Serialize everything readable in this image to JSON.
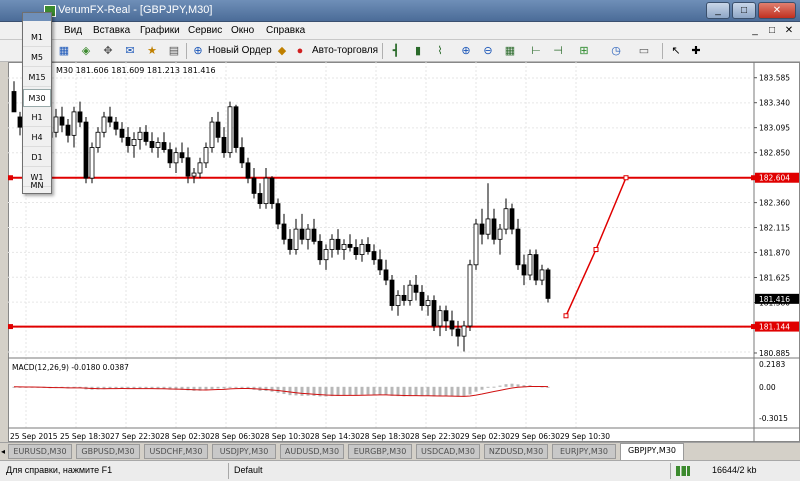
{
  "window": {
    "title": "VerumFX-Real - [GBPJPY,M30]",
    "min_label": "_",
    "max_label": "□",
    "close_label": "✕",
    "inner_min": "_",
    "inner_max": "□",
    "inner_close": "✕"
  },
  "menu": [
    "Вид",
    "Вставка",
    "Графики",
    "Сервис",
    "Окно",
    "Справка"
  ],
  "toolbar": {
    "new_order": "Новый Ордер",
    "auto_trading": "Авто-торговля"
  },
  "timeframes": [
    "M1",
    "M5",
    "M15",
    "M30",
    "H1",
    "H4",
    "D1",
    "W1",
    "MN"
  ],
  "active_timeframe": "M30",
  "ohlc_text": "181.606 181.609 181.213 181.416",
  "ohlc_prefix": "M30",
  "macd_label": "MACD(12,26,9) -0.0180 0.0387",
  "chart_data": {
    "type": "candlestick",
    "price_ticks": [
      "183.585",
      "183.340",
      "183.095",
      "182.850",
      "182.605",
      "182.360",
      "182.115",
      "181.870",
      "181.625",
      "181.380",
      "181.135",
      "180.885"
    ],
    "price_range": [
      180.875,
      183.7
    ],
    "current_price_label": "181.416",
    "current_price": 181.416,
    "levels": [
      {
        "label": "182.604",
        "value": 182.604,
        "color": "#e00000"
      },
      {
        "label": "181.144",
        "value": 181.144,
        "color": "#e00000"
      }
    ],
    "projection": [
      {
        "bar": 92,
        "value": 181.25
      },
      {
        "bar": 97,
        "value": 181.9
      },
      {
        "bar": 102,
        "value": 182.604
      }
    ],
    "time_labels": [
      "25 Sep 2015",
      "25 Sep 18:30",
      "27 Sep 22:30",
      "28 Sep 02:30",
      "28 Sep 06:30",
      "28 Sep 10:30",
      "28 Sep 14:30",
      "28 Sep 18:30",
      "28 Sep 22:30",
      "29 Sep 02:30",
      "29 Sep 06:30",
      "29 Sep 10:30"
    ],
    "macd_ticks": [
      "0.2183",
      "0.00",
      "-0.3015"
    ],
    "macd_range": [
      -0.36,
      0.24
    ],
    "candles": [
      [
        183.45,
        183.55,
        183.3,
        183.25
      ],
      [
        183.2,
        183.25,
        183.02,
        183.1
      ],
      [
        183.1,
        183.28,
        183.0,
        183.18
      ],
      [
        183.18,
        183.35,
        183.12,
        183.25
      ],
      [
        183.25,
        183.3,
        183.08,
        183.15
      ],
      [
        183.15,
        183.2,
        182.9,
        183.0
      ],
      [
        183.0,
        183.1,
        182.85,
        183.05
      ],
      [
        183.05,
        183.28,
        183.0,
        183.2
      ],
      [
        183.2,
        183.3,
        183.05,
        183.12
      ],
      [
        183.12,
        183.18,
        182.95,
        183.02
      ],
      [
        183.02,
        183.3,
        182.9,
        183.25
      ],
      [
        183.25,
        183.35,
        183.1,
        183.15
      ],
      [
        183.15,
        183.2,
        182.55,
        182.6
      ],
      [
        182.6,
        182.95,
        182.55,
        182.9
      ],
      [
        182.9,
        183.1,
        182.85,
        183.05
      ],
      [
        183.05,
        183.25,
        183.0,
        183.2
      ],
      [
        183.2,
        183.3,
        183.1,
        183.15
      ],
      [
        183.15,
        183.2,
        183.02,
        183.08
      ],
      [
        183.08,
        183.15,
        182.95,
        183.0
      ],
      [
        183.0,
        183.1,
        182.85,
        182.92
      ],
      [
        182.92,
        183.05,
        182.8,
        182.98
      ],
      [
        182.98,
        183.1,
        182.88,
        183.05
      ],
      [
        183.05,
        183.12,
        182.92,
        182.96
      ],
      [
        182.96,
        183.05,
        182.85,
        182.9
      ],
      [
        182.9,
        183.0,
        182.8,
        182.95
      ],
      [
        182.95,
        183.05,
        182.85,
        182.88
      ],
      [
        182.88,
        182.95,
        182.7,
        182.75
      ],
      [
        182.75,
        182.9,
        182.65,
        182.85
      ],
      [
        182.85,
        182.95,
        182.75,
        182.8
      ],
      [
        182.8,
        182.9,
        182.55,
        182.62
      ],
      [
        182.62,
        182.7,
        182.55,
        182.65
      ],
      [
        182.65,
        182.8,
        182.6,
        182.75
      ],
      [
        182.75,
        182.95,
        182.7,
        182.9
      ],
      [
        182.9,
        183.2,
        182.85,
        183.15
      ],
      [
        183.15,
        183.25,
        182.95,
        183.0
      ],
      [
        183.0,
        183.1,
        182.8,
        182.85
      ],
      [
        182.85,
        183.35,
        182.8,
        183.3
      ],
      [
        183.3,
        183.32,
        182.85,
        182.9
      ],
      [
        182.9,
        183.0,
        182.7,
        182.75
      ],
      [
        182.75,
        182.8,
        182.55,
        182.6
      ],
      [
        182.6,
        182.7,
        182.4,
        182.45
      ],
      [
        182.45,
        182.55,
        182.3,
        182.35
      ],
      [
        182.35,
        182.7,
        182.3,
        182.6
      ],
      [
        182.6,
        182.62,
        182.3,
        182.35
      ],
      [
        182.35,
        182.4,
        182.1,
        182.15
      ],
      [
        182.15,
        182.25,
        181.95,
        182.0
      ],
      [
        182.0,
        182.1,
        181.85,
        181.9
      ],
      [
        181.9,
        182.2,
        181.85,
        182.1
      ],
      [
        182.1,
        182.25,
        181.95,
        182.0
      ],
      [
        182.0,
        182.15,
        181.9,
        182.1
      ],
      [
        182.1,
        182.2,
        181.95,
        181.98
      ],
      [
        181.98,
        182.05,
        181.75,
        181.8
      ],
      [
        181.8,
        181.95,
        181.7,
        181.9
      ],
      [
        181.9,
        182.05,
        181.82,
        182.0
      ],
      [
        182.0,
        182.1,
        181.85,
        181.9
      ],
      [
        181.9,
        182.0,
        181.8,
        181.95
      ],
      [
        181.95,
        182.05,
        181.88,
        181.92
      ],
      [
        181.92,
        182.0,
        181.8,
        181.85
      ],
      [
        181.85,
        182.0,
        181.78,
        181.95
      ],
      [
        181.95,
        182.02,
        181.85,
        181.88
      ],
      [
        181.88,
        181.95,
        181.75,
        181.8
      ],
      [
        181.8,
        181.9,
        181.65,
        181.7
      ],
      [
        181.7,
        181.8,
        181.55,
        181.6
      ],
      [
        181.6,
        181.65,
        181.3,
        181.35
      ],
      [
        181.35,
        181.5,
        181.25,
        181.45
      ],
      [
        181.45,
        181.55,
        181.35,
        181.4
      ],
      [
        181.4,
        181.6,
        181.35,
        181.55
      ],
      [
        181.55,
        181.65,
        181.4,
        181.48
      ],
      [
        181.48,
        181.55,
        181.3,
        181.35
      ],
      [
        181.35,
        181.45,
        181.25,
        181.4
      ],
      [
        181.4,
        181.45,
        181.1,
        181.15
      ],
      [
        181.15,
        181.35,
        181.05,
        181.3
      ],
      [
        181.3,
        181.35,
        181.1,
        181.2
      ],
      [
        181.2,
        181.3,
        181.05,
        181.12
      ],
      [
        181.12,
        181.2,
        180.95,
        181.05
      ],
      [
        181.05,
        181.2,
        180.9,
        181.15
      ],
      [
        181.15,
        181.8,
        181.1,
        181.75
      ],
      [
        181.75,
        182.2,
        181.7,
        182.15
      ],
      [
        182.15,
        182.3,
        181.95,
        182.05
      ],
      [
        182.05,
        182.55,
        182.0,
        182.2
      ],
      [
        182.2,
        182.3,
        181.95,
        182.0
      ],
      [
        182.0,
        182.15,
        181.85,
        182.1
      ],
      [
        182.1,
        182.4,
        182.05,
        182.3
      ],
      [
        182.3,
        182.35,
        182.05,
        182.1
      ],
      [
        182.1,
        182.2,
        181.7,
        181.75
      ],
      [
        181.75,
        181.85,
        181.55,
        181.65
      ],
      [
        181.65,
        181.9,
        181.6,
        181.85
      ],
      [
        181.85,
        181.9,
        181.55,
        181.6
      ],
      [
        181.6,
        181.75,
        181.55,
        181.7
      ],
      [
        181.7,
        181.72,
        181.38,
        181.42
      ]
    ]
  },
  "tabs": [
    "EURUSD,M30",
    "GBPUSD,M30",
    "USDCHF,M30",
    "USDJPY,M30",
    "AUDUSD,M30",
    "EURGBP,M30",
    "USDCAD,M30",
    "NZDUSD,M30",
    "EURJPY,M30",
    "GBPJPY,M30"
  ],
  "active_tab": "GBPJPY,M30",
  "status": {
    "help": "Для справки, нажмите F1",
    "profile": "Default",
    "traffic": "16644/2 kb"
  }
}
